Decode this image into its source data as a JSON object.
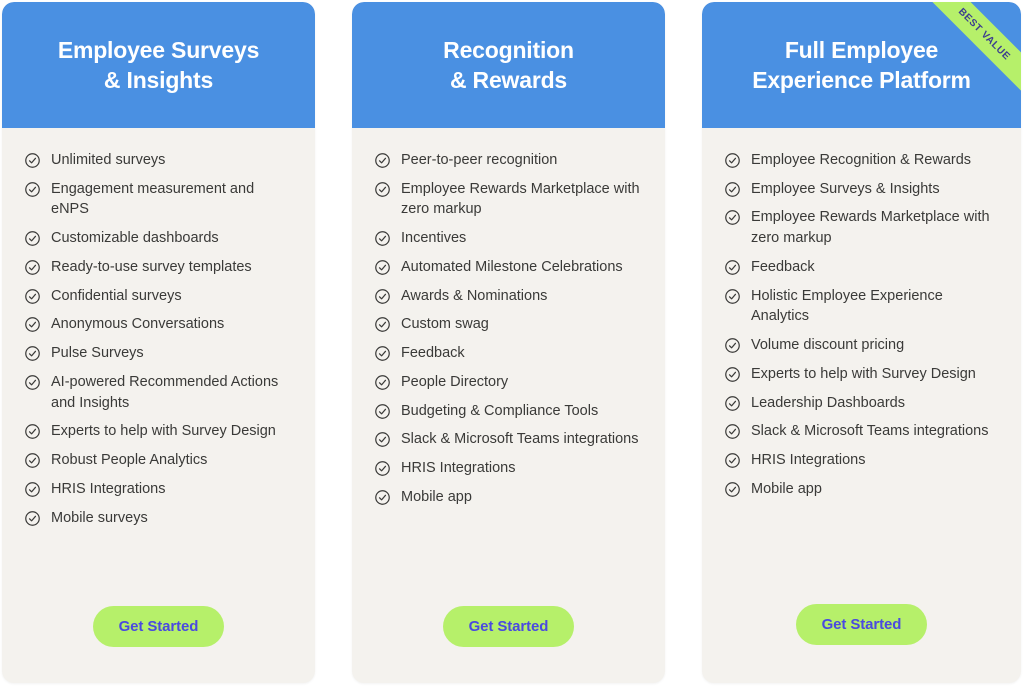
{
  "theme": {
    "page_background": "#ffffff",
    "card_background": "#f4f2ee",
    "header_blue": "#4a90e2",
    "cta_green": "#b6f06a",
    "cta_text": "#4a4ae0",
    "ribbon_green": "#b6f06a",
    "ribbon_text_color": "#3b3b8f",
    "feature_text": "#3a3a38"
  },
  "cta": {
    "label": "Get Started"
  },
  "icons": {
    "check": "check-circle-icon"
  },
  "cards": [
    {
      "id": "employee-surveys-insights",
      "title": "Employee Surveys\n& Insights",
      "title_line_1": "Employee Surveys",
      "title_line_2": "& Insights",
      "badge": null,
      "features": [
        "Unlimited surveys",
        "Engagement measurement and eNPS",
        "Customizable dashboards",
        "Ready-to-use survey templates",
        "Confidential surveys",
        "Anonymous Conversations",
        "Pulse Surveys",
        "AI-powered Recommended Actions and Insights",
        "Experts to help with Survey Design",
        "Robust People Analytics",
        "HRIS Integrations",
        "Mobile surveys"
      ],
      "cta_label": "Get Started"
    },
    {
      "id": "recognition-rewards",
      "title": "Recognition\n& Rewards",
      "title_line_1": "Recognition",
      "title_line_2": "& Rewards",
      "badge": null,
      "features": [
        "Peer-to-peer recognition",
        "Employee Rewards Marketplace with zero markup",
        "Incentives",
        "Automated Milestone Celebrations",
        "Awards & Nominations",
        "Custom swag",
        "Feedback",
        "People Directory",
        "Budgeting & Compliance Tools",
        "Slack & Microsoft Teams integrations",
        "HRIS Integrations",
        "Mobile app"
      ],
      "cta_label": "Get Started"
    },
    {
      "id": "full-employee-experience-platform",
      "title": "Full Employee\nExperience Platform",
      "title_line_1": "Full Employee",
      "title_line_2": "Experience Platform",
      "badge": "BEST VALUE",
      "features": [
        "Employee Recognition & Rewards",
        "Employee Surveys & Insights",
        "Employee Rewards Marketplace with zero markup",
        "Feedback",
        "Holistic Employee Experience Analytics",
        "Volume discount pricing",
        "Experts to help with Survey Design",
        "Leadership Dashboards",
        "Slack & Microsoft Teams integrations",
        "HRIS Integrations",
        "Mobile app"
      ],
      "cta_label": "Get Started"
    }
  ]
}
